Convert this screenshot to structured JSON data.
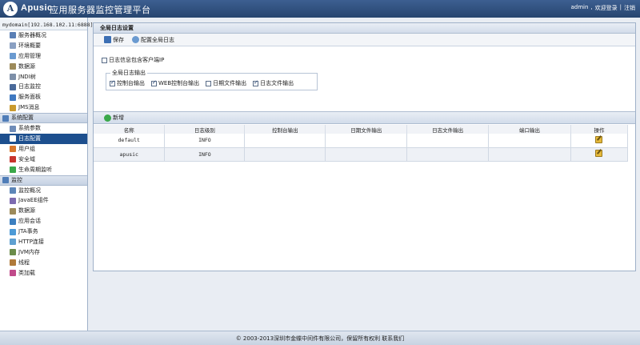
{
  "header": {
    "logo_text": "A",
    "brand": "Apusic",
    "subtitle": "应用服务器监控管理平台",
    "user": "admin",
    "welcome": "欢迎登录",
    "sep": "|",
    "logout": "注销"
  },
  "sidebar": {
    "domain": "mydomain[192.168.102.11:6888]",
    "group1": [
      {
        "label": "服务器概况",
        "icon": "server-icon",
        "color": "#5a7fb5"
      },
      {
        "label": "环境概要",
        "icon": "doc-icon",
        "color": "#8aa0c2"
      },
      {
        "label": "应用管理",
        "icon": "app-icon",
        "color": "#6a9ad0"
      },
      {
        "label": "数据源",
        "icon": "database-icon",
        "color": "#9c8a5a"
      },
      {
        "label": "JNDI树",
        "icon": "tree-icon",
        "color": "#7d8fa8"
      },
      {
        "label": "日志监控",
        "icon": "monitor-icon",
        "color": "#4a6a9a"
      },
      {
        "label": "服务面板",
        "icon": "panel-icon",
        "color": "#3f78c0"
      },
      {
        "label": "JMS消息",
        "icon": "message-icon",
        "color": "#c99a2e"
      }
    ],
    "section_config": "系统配置",
    "group2": [
      {
        "label": "系统参数",
        "icon": "params-icon",
        "color": "#6f8cb8",
        "active": false
      },
      {
        "label": "日志配置",
        "icon": "log-config-icon",
        "color": "#ffffff",
        "active": true
      },
      {
        "label": "用户组",
        "icon": "user-group-icon",
        "color": "#d9772b",
        "active": false
      },
      {
        "label": "安全域",
        "icon": "security-icon",
        "color": "#c8342c",
        "active": false
      },
      {
        "label": "生命周期监听",
        "icon": "lifecycle-icon",
        "color": "#3aa84a",
        "active": false
      }
    ],
    "section_monitor": "监控",
    "group3": [
      {
        "label": "监控概况",
        "icon": "chart-icon",
        "color": "#5d86b8"
      },
      {
        "label": "JavaEE组件",
        "icon": "component-icon",
        "color": "#7d6bb0"
      },
      {
        "label": "数据源",
        "icon": "database-icon",
        "color": "#9c8a5a"
      },
      {
        "label": "应用会话",
        "icon": "session-icon",
        "color": "#3c7fbf"
      },
      {
        "label": "JTA事务",
        "icon": "transaction-icon",
        "color": "#4c9ad6"
      },
      {
        "label": "HTTP连接",
        "icon": "http-icon",
        "color": "#5fa0d0"
      },
      {
        "label": "JVM内存",
        "icon": "memory-icon",
        "color": "#6b8c4a"
      },
      {
        "label": "线程",
        "icon": "thread-icon",
        "color": "#b07a3a"
      },
      {
        "label": "类加载",
        "icon": "classload-icon",
        "color": "#c04a8a"
      }
    ]
  },
  "panel": {
    "title": "全局日志设置",
    "save_label": "保存",
    "config_label": "配置全局日志",
    "option_client_ip": {
      "label": "日志信息包含客户端IP",
      "checked": false
    },
    "fieldset_label": "全局日志输出",
    "outputs": [
      {
        "label": "控制台输出",
        "checked": true
      },
      {
        "label": "WEB控制台输出",
        "checked": true
      },
      {
        "label": "日期文件输出",
        "checked": false
      },
      {
        "label": "日志文件输出",
        "checked": true
      }
    ],
    "add_label": "新增",
    "columns": [
      "名称",
      "日志级别",
      "控制台输出",
      "日期文件输出",
      "日志文件输出",
      "端口输出",
      "操作"
    ],
    "rows": [
      {
        "name": "default",
        "level": "INFO"
      },
      {
        "name": "apusic",
        "level": "INFO"
      }
    ]
  },
  "footer": {
    "text": "© 2003-2013深圳市金蝶中间件有限公司，保留所有权利  联系我们"
  }
}
